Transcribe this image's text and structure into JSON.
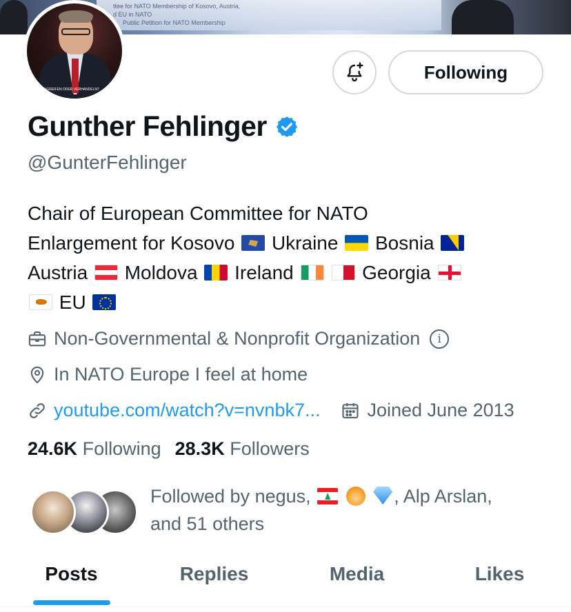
{
  "banner": {
    "poster_lines": [
      "ttee for NATO Membership of Kosovo, Austria,",
      "d EU in NATO",
      "Public Petition for NATO Membership"
    ]
  },
  "profile": {
    "avatar_caption": "EINGREIFEN ODER VERHANDELN?",
    "name": "Gunther Fehlinger",
    "handle": "@GunterFehlinger",
    "verified": true,
    "verified_color": "#1d9bf0"
  },
  "actions": {
    "notify_icon": "bell-plus-icon",
    "follow_label": "Following"
  },
  "bio": {
    "line1": "Chair of European Committee for NATO",
    "line2_a": "Enlargement for Kosovo",
    "line2_b": "Ukraine",
    "line2_c": "Bosnia",
    "line3_a": "Austria",
    "line3_b": "Moldova",
    "line3_c": "Ireland",
    "line3_d": "Georgia",
    "line4_a": "EU"
  },
  "meta": {
    "category": "Non-Governmental & Nonprofit Organization",
    "location": "In NATO Europe I feel at home",
    "link": "youtube.com/watch?v=nvnbk7...",
    "joined": "Joined June 2013"
  },
  "stats": {
    "following_count": "24.6K",
    "following_label": "Following",
    "followers_count": "28.3K",
    "followers_label": "Followers"
  },
  "followed_by": {
    "prefix": "Followed by negus,",
    "middle": ", Alp Arslan,",
    "suffix": "and 51 others"
  },
  "tabs": [
    {
      "label": "Posts",
      "active": true
    },
    {
      "label": "Replies",
      "active": false
    },
    {
      "label": "Media",
      "active": false
    },
    {
      "label": "Likes",
      "active": false
    }
  ],
  "colors": {
    "accent": "#1d9bf0",
    "text_primary": "#0f1419",
    "text_secondary": "#536471",
    "border": "#cfd9de"
  }
}
